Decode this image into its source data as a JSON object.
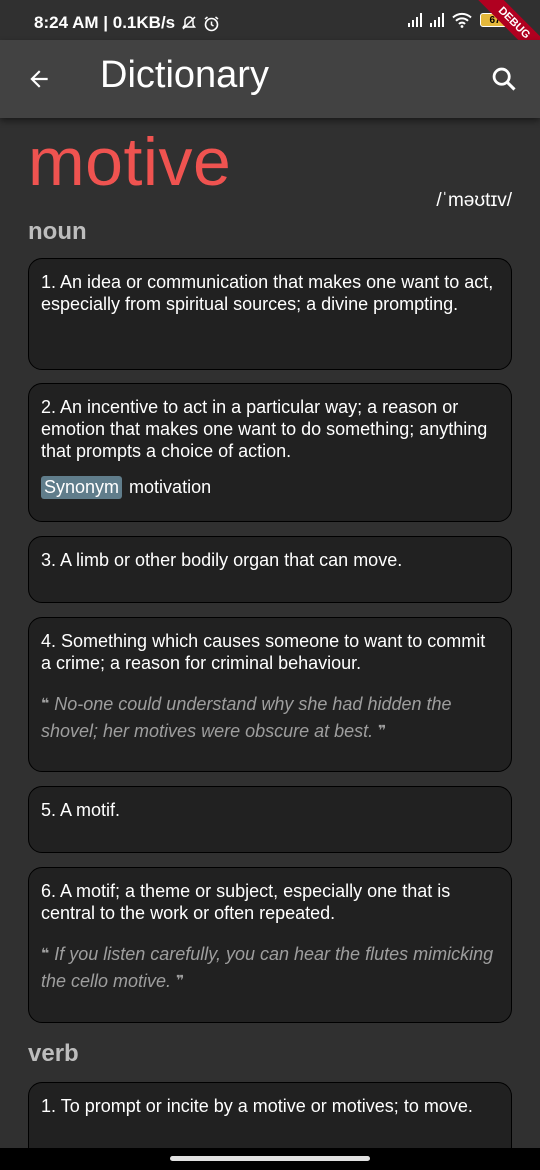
{
  "status_bar": {
    "time_speed": "8:24 AM | 0.1KB/s",
    "battery": "67",
    "debug": "DEBUG"
  },
  "app_bar": {
    "title": "Dictionary"
  },
  "entry": {
    "word": "motive",
    "phonetic": "/ˈməʊtɪv/",
    "accent_color": "#ef5350",
    "noun": {
      "label": "noun",
      "definitions": [
        {
          "text": "1. An idea or communication that makes one want to act, especially from spiritual sources; a divine prompting."
        },
        {
          "text": "2. An incentive to act in a particular way; a reason or emotion that makes one want to do something; anything that prompts a choice of action.",
          "synonym_label": "Synonym",
          "synonym": "motivation"
        },
        {
          "text": "3. A limb or other bodily organ that can move."
        },
        {
          "text": "4. Something which causes someone to want to commit a crime; a reason for criminal behaviour.",
          "example": "No-one could understand why she had hidden the shovel; her motives were obscure at best."
        },
        {
          "text": "5. A motif."
        },
        {
          "text": "6. A motif; a theme or subject, especially one that is central to the work or often repeated.",
          "example": "If you listen carefully, you can hear the flutes mimicking the cello motive."
        }
      ]
    },
    "verb": {
      "label": "verb",
      "definitions": [
        {
          "text": "1. To prompt or incite by a motive or motives; to move."
        }
      ]
    }
  },
  "quote_open": "❝",
  "quote_close": "❞"
}
